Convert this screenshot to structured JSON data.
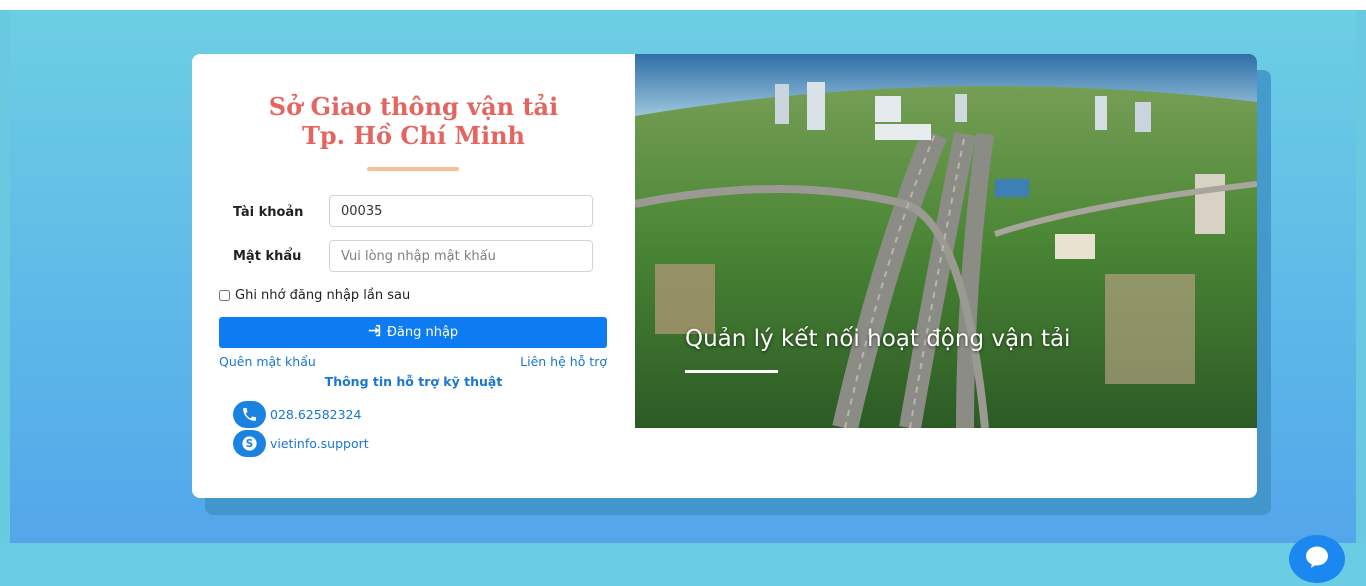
{
  "login": {
    "title_line1": "Sở Giao thông vận tải",
    "title_line2": "Tp. Hồ Chí Minh",
    "username_label": "Tài khoản",
    "username_value": "00035",
    "password_label": "Mật khẩu",
    "password_placeholder": "Vui lòng nhập mật khẩu",
    "remember_label": "Ghi nhớ đăng nhập lần sau",
    "login_button": "Đăng nhập",
    "forgot_password": "Quên mật khẩu",
    "contact_support": "Liên hệ hỗ trợ",
    "support_title": "Thông tin hỗ trợ kỹ thuật",
    "phone": "028.62582324",
    "skype": "vietinfo.support"
  },
  "hero": {
    "caption": "Quản lý kết nối hoạt động vận tải"
  },
  "colors": {
    "title": "#e4655f",
    "accent_line": "#fbbd97",
    "primary": "#0d7cf2",
    "link": "#1a76d2",
    "page_bg": "#5db9e8"
  },
  "icons": {
    "login_icon": "sign-in-icon",
    "phone_icon": "phone-icon",
    "skype_icon": "skype-icon",
    "chat_icon": "chat-bubble-icon"
  }
}
